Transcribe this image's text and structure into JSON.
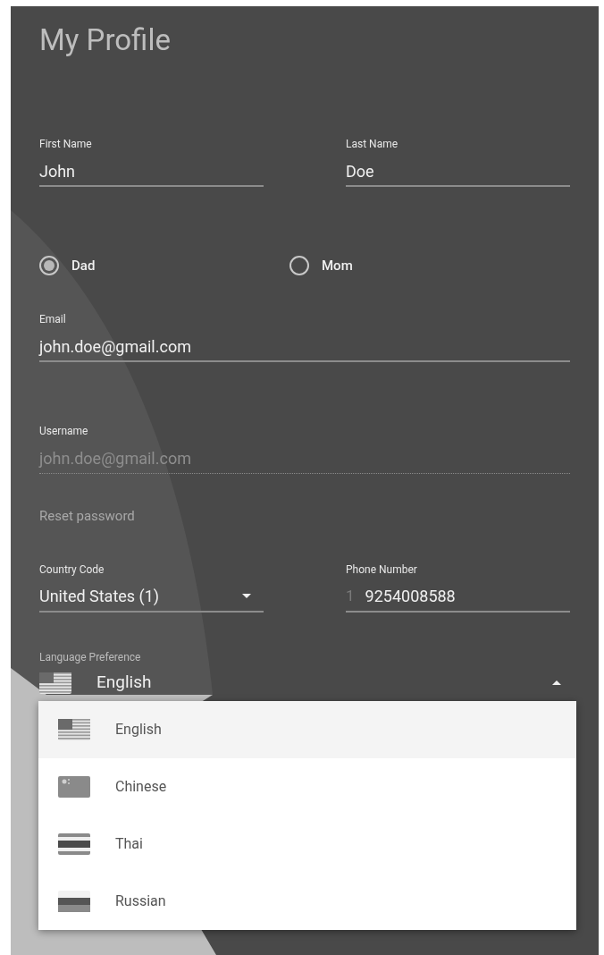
{
  "title": "My Profile",
  "name_fields": [
    {
      "label": "First Name",
      "value": "John"
    },
    {
      "label": "Last Name",
      "value": "Doe"
    }
  ],
  "parent_options": [
    {
      "label": "Dad",
      "selected": true
    },
    {
      "label": "Mom",
      "selected": false
    }
  ],
  "email": {
    "label": "Email",
    "value": "john.doe@gmail.com",
    "disabled": false
  },
  "username": {
    "label": "Username",
    "value": "john.doe@gmail.com",
    "disabled": true
  },
  "reset_link": "Reset password",
  "country_code": {
    "label": "Country Code",
    "value": "United States (1)"
  },
  "phone": {
    "label": "Phone Number",
    "prefix": "1",
    "value": "9254008588"
  },
  "language": {
    "label": "Language Preference",
    "value": "English",
    "kind": "us",
    "expanded": true,
    "options": [
      {
        "label": "English",
        "kind": "us",
        "selected": true
      },
      {
        "label": "Chinese",
        "kind": "cn",
        "selected": false
      },
      {
        "label": "Thai",
        "kind": "th",
        "selected": false
      },
      {
        "label": "Russian",
        "kind": "ru",
        "selected": false
      }
    ]
  }
}
